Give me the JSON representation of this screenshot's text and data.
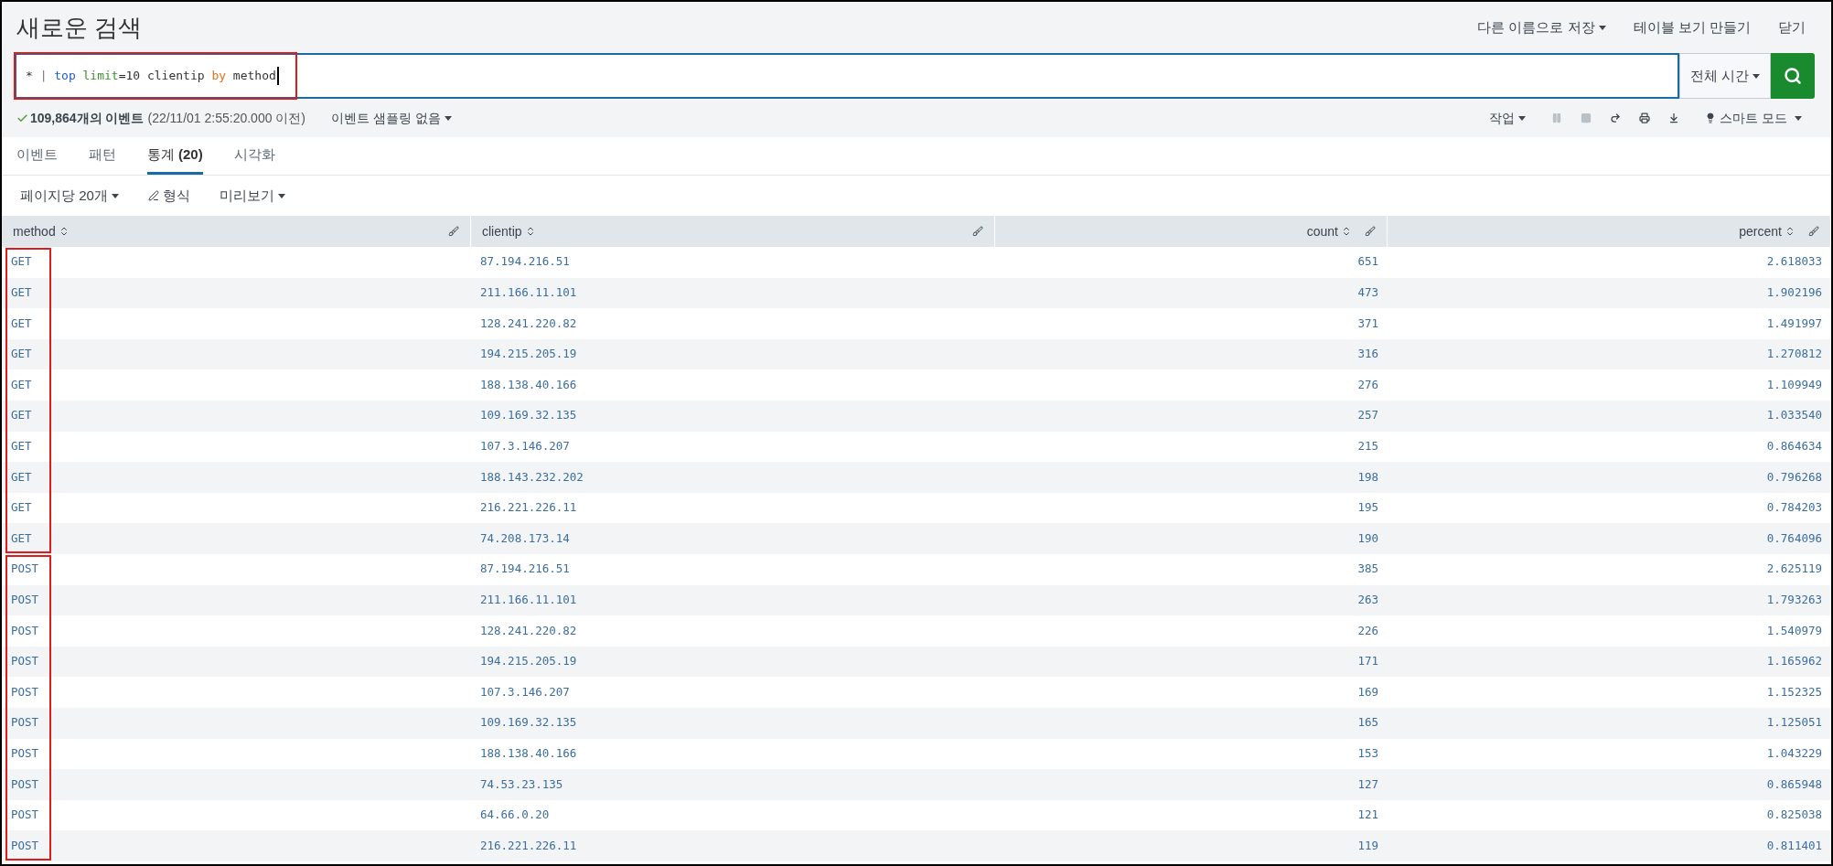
{
  "page": {
    "title": "새로운 검색",
    "actions": [
      {
        "label": "다른 이름으로 저장",
        "dropdown": true
      },
      {
        "label": "테이블 보기 만들기",
        "dropdown": false
      },
      {
        "label": "닫기",
        "dropdown": false
      }
    ]
  },
  "search": {
    "focused": true,
    "highlighted": true,
    "query_tokens": [
      {
        "text": "*",
        "kind": "plain"
      },
      {
        "text": "|",
        "kind": "pipe"
      },
      {
        "text": "top",
        "kind": "command"
      },
      {
        "text": "limit",
        "kind": "argument"
      },
      {
        "text": "=10",
        "kind": "value"
      },
      {
        "text": "clientip",
        "kind": "plain"
      },
      {
        "text": "by",
        "kind": "keyword"
      },
      {
        "text": "method",
        "kind": "plain"
      }
    ],
    "time_range": "전체 시간"
  },
  "status": {
    "event_count": "109,864개의 이벤트",
    "time": "(22/11/01 2:55:20.000 이전)",
    "sampling": "이벤트 샘플링 없음"
  },
  "job": {
    "label": "작업",
    "controls": [
      {
        "kind": "pause",
        "disabled": true
      },
      {
        "kind": "stop",
        "disabled": true
      },
      {
        "kind": "share",
        "disabled": false
      },
      {
        "kind": "print",
        "disabled": false
      },
      {
        "kind": "export",
        "disabled": false
      }
    ],
    "mode": "스마트 모드"
  },
  "tabs": [
    {
      "label": "이벤트",
      "selected": false
    },
    {
      "label": "패턴",
      "selected": false
    },
    {
      "label": "통계",
      "count": "(20)",
      "selected": true
    },
    {
      "label": "시각화",
      "selected": false
    }
  ],
  "toolbar": {
    "per_page": "페이지당 20개",
    "format": "형식",
    "preview": "미리보기"
  },
  "table": {
    "columns": [
      {
        "label": "method",
        "kind": "text"
      },
      {
        "label": "clientip",
        "kind": "text"
      },
      {
        "label": "count",
        "kind": "number"
      },
      {
        "label": "percent",
        "kind": "number"
      }
    ],
    "groups": [
      {
        "highlighted": true,
        "rows": [
          [
            "GET",
            "87.194.216.51",
            "651",
            "2.618033"
          ],
          [
            "GET",
            "211.166.11.101",
            "473",
            "1.902196"
          ],
          [
            "GET",
            "128.241.220.82",
            "371",
            "1.491997"
          ],
          [
            "GET",
            "194.215.205.19",
            "316",
            "1.270812"
          ],
          [
            "GET",
            "188.138.40.166",
            "276",
            "1.109949"
          ],
          [
            "GET",
            "109.169.32.135",
            "257",
            "1.033540"
          ],
          [
            "GET",
            "107.3.146.207",
            "215",
            "0.864634"
          ],
          [
            "GET",
            "188.143.232.202",
            "198",
            "0.796268"
          ],
          [
            "GET",
            "216.221.226.11",
            "195",
            "0.784203"
          ],
          [
            "GET",
            "74.208.173.14",
            "190",
            "0.764096"
          ]
        ]
      },
      {
        "highlighted": true,
        "rows": [
          [
            "POST",
            "87.194.216.51",
            "385",
            "2.625119"
          ],
          [
            "POST",
            "211.166.11.101",
            "263",
            "1.793263"
          ],
          [
            "POST",
            "128.241.220.82",
            "226",
            "1.540979"
          ],
          [
            "POST",
            "194.215.205.19",
            "171",
            "1.165962"
          ],
          [
            "POST",
            "107.3.146.207",
            "169",
            "1.152325"
          ],
          [
            "POST",
            "109.169.32.135",
            "165",
            "1.125051"
          ],
          [
            "POST",
            "188.138.40.166",
            "153",
            "1.043229"
          ],
          [
            "POST",
            "74.53.23.135",
            "127",
            "0.865948"
          ],
          [
            "POST",
            "64.66.0.20",
            "121",
            "0.825038"
          ],
          [
            "POST",
            "216.221.226.11",
            "119",
            "0.811401"
          ]
        ]
      }
    ]
  }
}
